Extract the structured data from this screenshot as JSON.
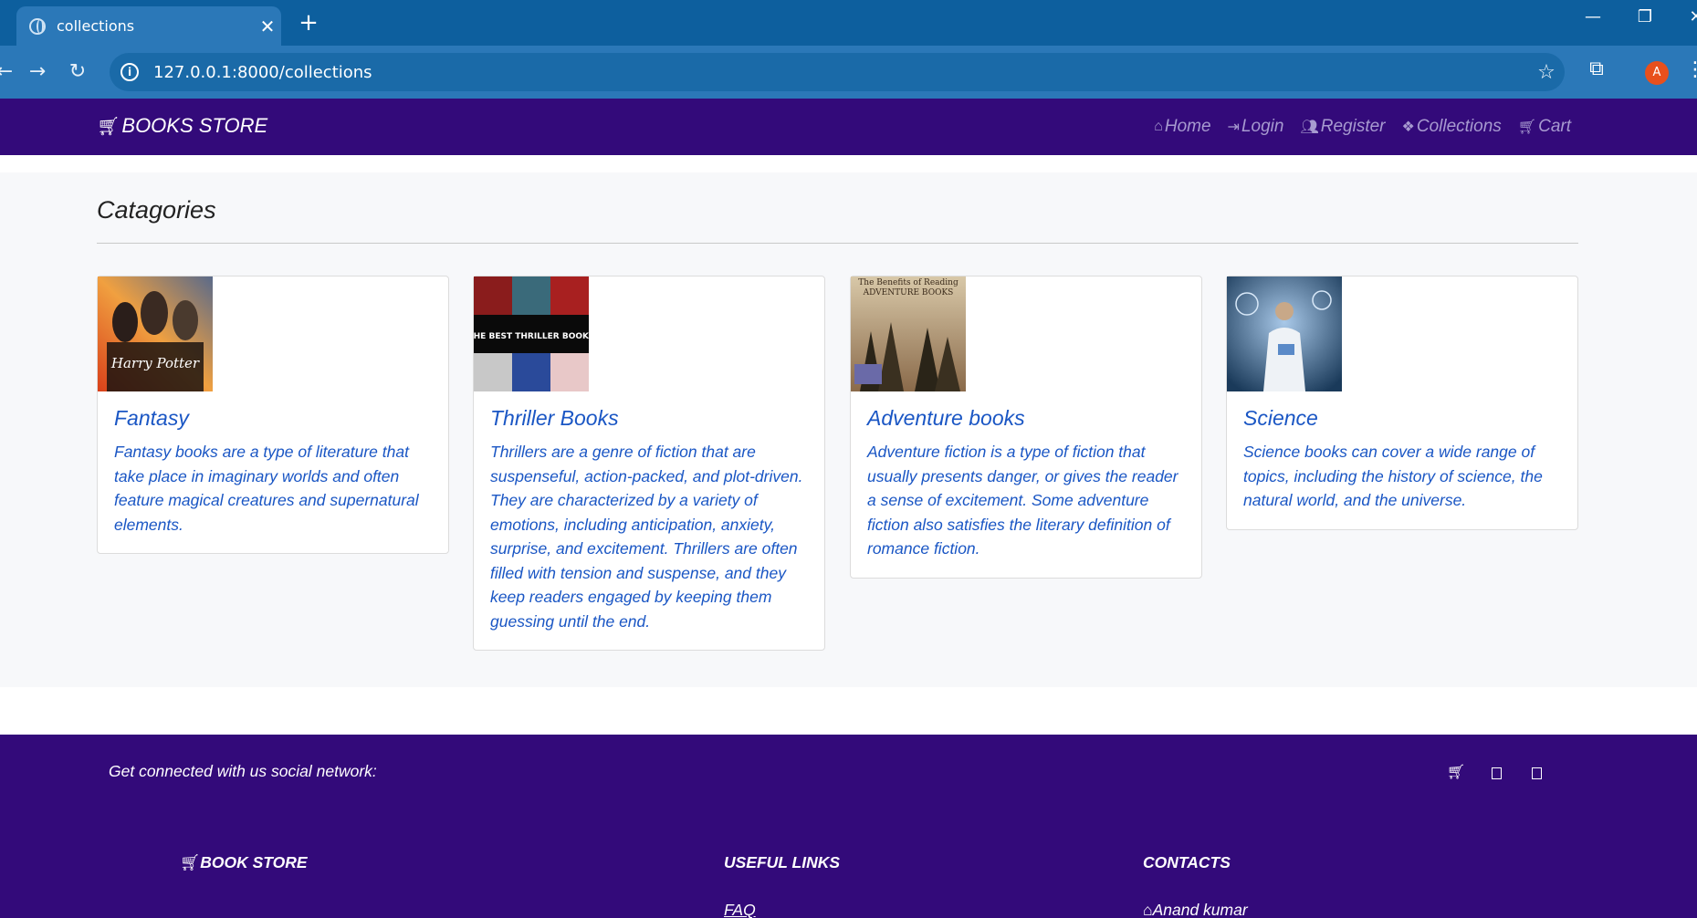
{
  "browser": {
    "tab_title": "collections",
    "tab_close": "✕",
    "new_tab": "+",
    "url": "127.0.0.1:8000/collections",
    "profile_initial": "A",
    "window_controls": {
      "minimize": "—",
      "restore": "❐",
      "close": "✕"
    }
  },
  "navbar": {
    "brand": "BOOKS STORE",
    "links": [
      {
        "label": "Home",
        "icon": "home-icon"
      },
      {
        "label": "Login",
        "icon": "sign-in-icon"
      },
      {
        "label": "Register",
        "icon": "users-icon"
      },
      {
        "label": "Collections",
        "icon": "cubes-icon"
      },
      {
        "label": "Cart",
        "icon": "cart-icon"
      }
    ]
  },
  "main": {
    "heading": "Catagories",
    "cards": [
      {
        "title": "Fantasy",
        "text": "Fantasy books are a type of literature that take place in imaginary worlds and often feature magical creatures and supernatural elements.",
        "image_text": "Harry Potter"
      },
      {
        "title": "Thriller Books",
        "text": "Thrillers are a genre of fiction that are suspenseful, action-packed, and plot-driven. They are characterized by a variety of emotions, including anticipation, anxiety, surprise, and excitement. Thrillers are often filled with tension and suspense, and they keep readers engaged by keeping them guessing until the end.",
        "image_text": "THE BEST THRILLER BOOKS"
      },
      {
        "title": "Adventure books",
        "text": "Adventure fiction is a type of fiction that usually presents danger, or gives the reader a sense of excitement. Some adventure fiction also satisfies the literary definition of romance fiction.",
        "image_text": "The Benefits of Reading ADVENTURE BOOKS"
      },
      {
        "title": "Science",
        "text": "Science books can cover a wide range of topics, including the history of science, the natural world, and the universe.",
        "image_text": ""
      }
    ]
  },
  "footer": {
    "social_text": "Get connected with us social network:",
    "brand_heading": "BOOK STORE",
    "useful_links_heading": "USEFUL LINKS",
    "contacts_heading": "CONTACTS",
    "faq_link": "FAQ",
    "contact_name": "Anand kumar"
  },
  "colors": {
    "navbar_bg": "#330a7a",
    "link_blue": "#1a56c4",
    "chrome_blue": "#2b78b8"
  }
}
